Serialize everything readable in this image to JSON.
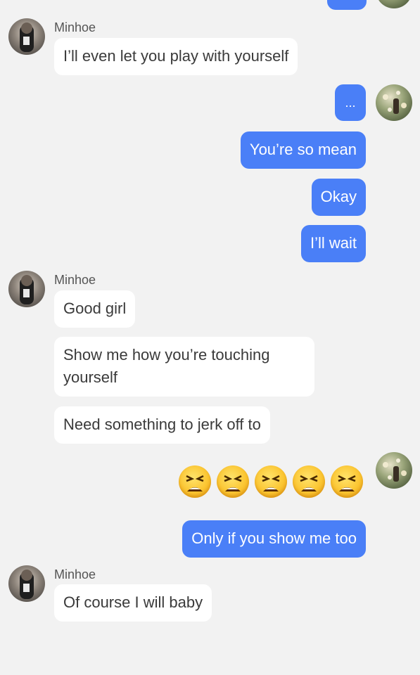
{
  "contact": {
    "name": "Minhoe"
  },
  "messages": [
    {
      "from": "them",
      "text": "I’ll even let you play with yourself"
    },
    {
      "from": "me",
      "text": "..."
    },
    {
      "from": "me",
      "text": "You’re so mean"
    },
    {
      "from": "me",
      "text": "Okay"
    },
    {
      "from": "me",
      "text": "I’ll wait"
    },
    {
      "from": "them",
      "text": "Good girl"
    },
    {
      "from": "them",
      "text": "Show me how you’re touching yourself"
    },
    {
      "from": "them",
      "text": "Need something to jerk off to"
    },
    {
      "from": "me",
      "emoji": "tired-face",
      "count": 5
    },
    {
      "from": "me",
      "text": "Only if you show me too"
    },
    {
      "from": "them",
      "text": "Of course I will baby"
    }
  ],
  "colors": {
    "outgoing": "#4a7ff7",
    "incoming": "#ffffff",
    "background": "#f2f2f2"
  }
}
